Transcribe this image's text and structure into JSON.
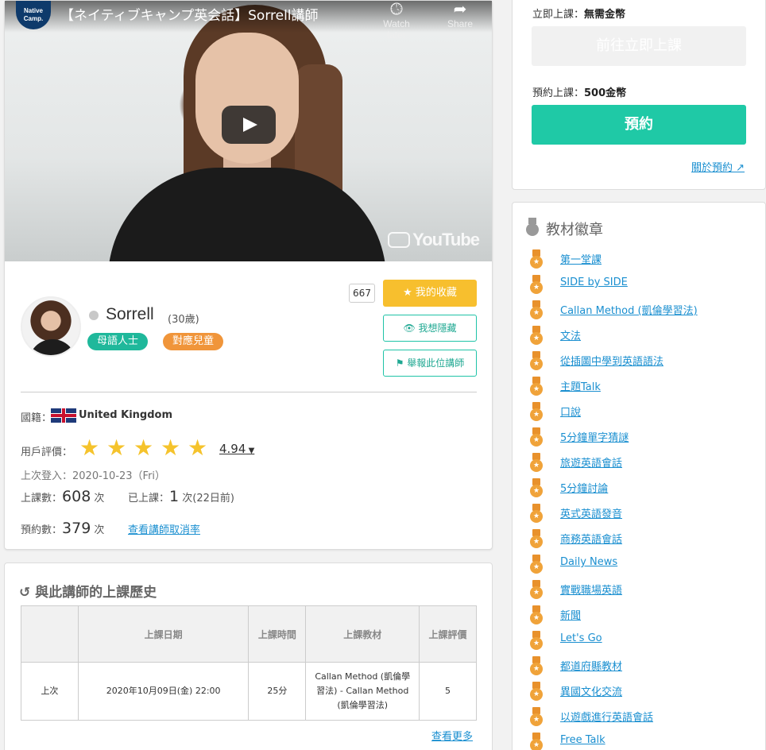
{
  "video": {
    "logo_text": "Native Camp.",
    "title": "【ネイティブキャンプ英会話】Sorrell講師",
    "watch_later": "Watch later",
    "share": "Share",
    "watermark": "YouTube"
  },
  "profile": {
    "favorite_count": "667",
    "favorite_label": "我的收藏",
    "hide_label": "我想隱藏",
    "report_label": "舉報此位講師",
    "name": "Sorrell",
    "age": "(30歲)",
    "tags": [
      "母語人士",
      "對應兒童"
    ],
    "nationality_label": "國籍：",
    "nationality": "United Kingdom",
    "rating_label": "用戶評價：",
    "rating": "4.94",
    "rating_stars": 5,
    "last_login": "上次登入：2020-10-23（Fri）",
    "lessons_label": "上課數：",
    "lessons_count": "608",
    "times_unit": "次",
    "taken_label": "已上課：",
    "taken_count": "1",
    "taken_suffix": "次(22日前)",
    "bookings_label": "預約數：",
    "bookings_count": "379",
    "cancel_rate_link": "查看講師取消率"
  },
  "history": {
    "title": "與此講師的上課歷史",
    "headers": [
      "",
      "上課日期",
      "上課時間",
      "上課教材",
      "上課評價"
    ],
    "rows": [
      [
        "上次",
        "2020年10月09日(金) 22:00",
        "25分",
        "Callan Method (凱倫學習法) - Callan Method (凱倫學習法)",
        "5"
      ]
    ],
    "see_more": "查看更多"
  },
  "booking": {
    "instant_label": "立即上課：",
    "instant_value": "無需金幣",
    "instant_button": "前往立即上課",
    "reserve_label": "預約上課：",
    "reserve_value": "500金幣",
    "reserve_button": "預約",
    "about_link": "關於預約"
  },
  "badges": {
    "title": "教材徽章",
    "items": [
      "第一堂課",
      "SIDE by SIDE",
      "Callan Method (凱倫學習法)",
      "文法",
      "從插圖中學到英語語法",
      "主題Talk",
      "口說",
      "5分鐘單字猜謎",
      "旅遊英語會話",
      "5分鐘討論",
      "英式英語發音",
      "商務英語會話",
      "Daily News",
      "實戰職場英語",
      "新聞",
      "Let's Go",
      "都道府縣教材",
      "異國文化交流",
      "以遊戲進行英語會話",
      "Free Talk"
    ]
  },
  "colors": {
    "accent_green": "#1fc9a6",
    "favorite_yellow": "#f7bf2e",
    "star": "#f5c32c",
    "link": "#1a8fd0",
    "tag_green": "#1fb89b",
    "tag_orange": "#f0953a",
    "medal": "#f0a33a"
  }
}
